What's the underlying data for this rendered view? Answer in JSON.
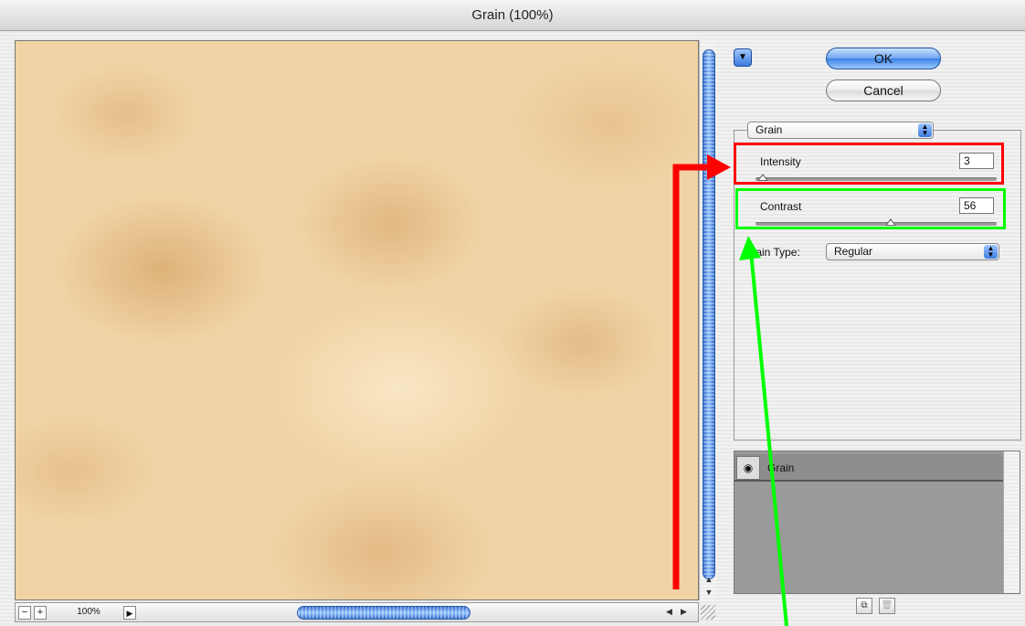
{
  "window": {
    "title": "Grain (100%)"
  },
  "bottom_bar": {
    "zoom_out": "−",
    "zoom_in": "+",
    "zoom_level": "100%",
    "zoom_menu": "▶",
    "scroll_left": "◀",
    "scroll_right": "▶"
  },
  "vscroll": {
    "up": "▲",
    "down": "▼"
  },
  "buttons": {
    "ok": "OK",
    "cancel": "Cancel",
    "collapse": "▼"
  },
  "filter": {
    "selected": "Grain",
    "params": [
      {
        "label": "Intensity",
        "value": "3",
        "fraction": 0.03
      },
      {
        "label": "Contrast",
        "value": "56",
        "fraction": 0.56
      }
    ],
    "grain_type_label": "Grain Type:",
    "grain_type_value": "Regular"
  },
  "layers": {
    "items": [
      {
        "name": "Grain",
        "visible_icon": "eye-icon"
      }
    ],
    "new_layer_icon": "new-effect-layer-icon",
    "delete_icon": "trash-icon"
  },
  "colors": {
    "annotation_red": "#ff0000",
    "annotation_green": "#00ff00",
    "accent_blue": "#3b7ce0"
  }
}
